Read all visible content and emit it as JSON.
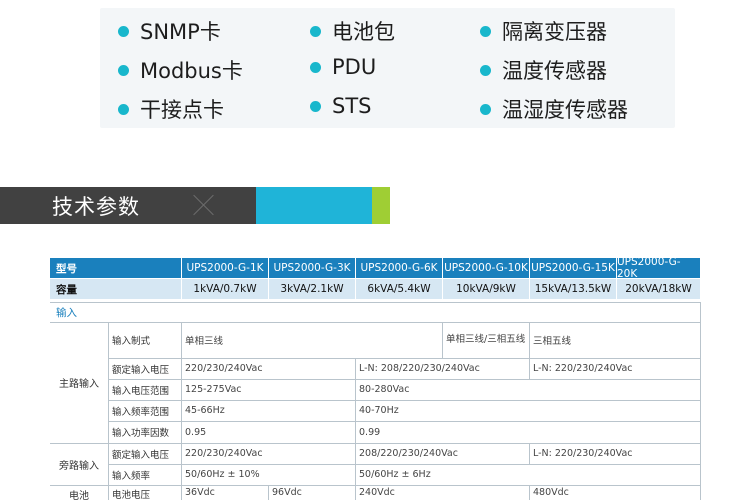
{
  "accessories": [
    "SNMP卡",
    "Modbus卡",
    "干接点卡",
    "电池包",
    "PDU",
    "STS",
    "隔离变压器",
    "温度传感器",
    "温湿度传感器"
  ],
  "section": {
    "title": "技术参数"
  },
  "table": {
    "model_label": "型号",
    "models": [
      "UPS2000-G-1K",
      "UPS2000-G-3K",
      "UPS2000-G-6K",
      "UPS2000-G-10K",
      "UPS2000-G-15K",
      "UPS2000-G-20K"
    ],
    "capacity_label": "容量",
    "capacities": [
      "1kVA/0.7kW",
      "3kVA/2.1kW",
      "6kVA/5.4kW",
      "10kVA/9kW",
      "15kVA/13.5kW",
      "20kVA/18kW"
    ],
    "input_group": "输入",
    "main_input": "主路输入",
    "bypass_input": "旁路输入",
    "battery": "电池",
    "rows": {
      "phase_label": "输入制式",
      "phase_single": "单相三线",
      "phase_mixed": "单相三线/三相五线",
      "phase_three": "三相五线",
      "rated_v_label": "额定输入电压",
      "rated_v_a": "220/230/240Vac",
      "rated_v_b": "L-N: 208/220/230/240Vac",
      "rated_v_c": "L-N: 220/230/240Vac",
      "v_range_label": "输入电压范围",
      "v_range_a": "125-275Vac",
      "v_range_b": "80-280Vac",
      "f_range_label": "输入频率范围",
      "f_range_a": "45-66Hz",
      "f_range_b": "40-70Hz",
      "pf_label": "输入功率因数",
      "pf_a": "0.95",
      "pf_b": "0.99",
      "byp_v_label": "额定输入电压",
      "byp_v_a": "220/230/240Vac",
      "byp_v_b": "208/220/230/240Vac",
      "byp_v_c": "L-N: 220/230/240Vac",
      "byp_f_label": "输入频率",
      "byp_f_a": "50/60Hz ± 10%",
      "byp_f_b": "50/60Hz ± 6Hz",
      "bat_v_label": "电池电压",
      "bat_v_a": "36Vdc",
      "bat_v_b": "96Vdc",
      "bat_v_c": "240Vdc",
      "bat_v_d": "480Vdc"
    }
  }
}
